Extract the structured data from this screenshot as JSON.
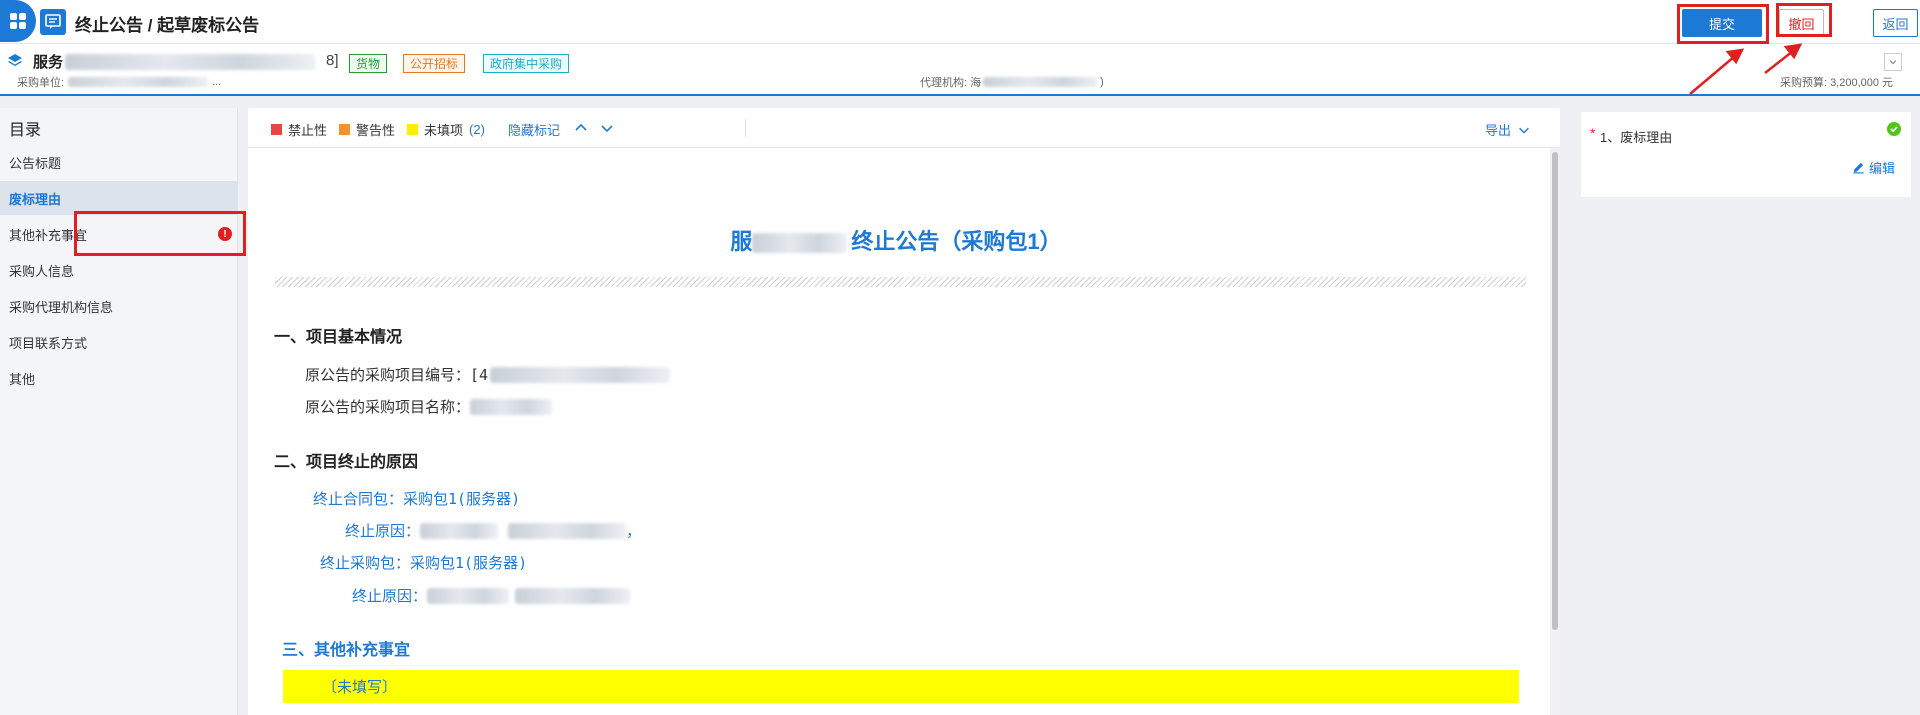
{
  "header": {
    "title": "终止公告 / 起草废标公告",
    "submit_label": "提交",
    "withdraw_label": "撤回",
    "back_label": "返回"
  },
  "project": {
    "name_visible": "服务",
    "name_suffix": "8]",
    "tags": [
      "货物",
      "公开招标",
      "政府集中采购"
    ],
    "purchaser_label": "采购单位:",
    "purchaser_suffix": "...",
    "agency_label": "代理机构:",
    "agency_prefix": "海",
    "agency_suffix": ")",
    "budget_label": "采购预算:",
    "budget_value": "3,200,000 元"
  },
  "toc": {
    "title": "目录",
    "items": [
      {
        "label": "公告标题",
        "active": false,
        "error": false
      },
      {
        "label": "废标理由",
        "active": true,
        "error": false
      },
      {
        "label": "其他补充事宜",
        "active": false,
        "error": true
      },
      {
        "label": "采购人信息",
        "active": false,
        "error": false
      },
      {
        "label": "采购代理机构信息",
        "active": false,
        "error": false
      },
      {
        "label": "项目联系方式",
        "active": false,
        "error": false
      },
      {
        "label": "其他",
        "active": false,
        "error": false
      }
    ],
    "error_glyph": "!"
  },
  "toolbar": {
    "legend_forbidden": "禁止性",
    "legend_warning": "警告性",
    "legend_unfilled": "未填项",
    "unfilled_count": "(2)",
    "hide_marks": "隐藏标记",
    "export": "导出",
    "colors": {
      "forbidden": "#e84545",
      "warning": "#f5922f",
      "unfilled": "#ffee00"
    }
  },
  "document": {
    "title_suffix": "终止公告（采购包1）",
    "title_prefix": "服",
    "section1_heading": "一、项目基本情况",
    "project_no_label": "原公告的采购项目编号：[4",
    "project_name_label": "原公告的采购项目名称：",
    "section2_heading": "二、项目终止的原因",
    "contract_package_line": "终止合同包：采购包1(服务器)",
    "reason_label_1": "终止原因：",
    "reason_1_tail": "，",
    "purchase_package_line": "终止采购包：采购包1(服务器)",
    "reason_label_2": "终止原因：",
    "section3_heading": "三、其他补充事宜",
    "unfilled_placeholder": "〔未填写〕"
  },
  "right_panel": {
    "item_label": "1、废标理由",
    "required_mark": "*",
    "edit_label": "编辑"
  },
  "colors": {
    "accent": "#1c79d6",
    "highlight_red": "#e02020",
    "unfilled_yellow": "#ffff00"
  }
}
